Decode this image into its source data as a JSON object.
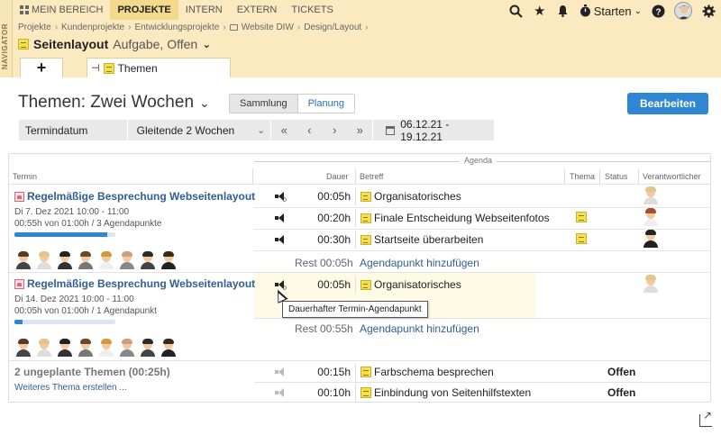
{
  "sidebar": {
    "label": "NAVIGATOR"
  },
  "topnav": {
    "items": [
      {
        "label": "MEIN BEREICH"
      },
      {
        "label": "PROJEKTE"
      },
      {
        "label": "INTERN"
      },
      {
        "label": "EXTERN"
      },
      {
        "label": "TICKETS"
      }
    ],
    "starten_label": "Starten"
  },
  "breadcrumb": [
    "Projekte",
    "Kundenprojekte",
    "Entwicklungsprojekte",
    "Website DIW",
    "Design/Layout"
  ],
  "page": {
    "title": "Seitenlayout",
    "subtitle": "Aufgabe, Offen"
  },
  "tabs": {
    "plus": "+",
    "doc_label": "Themen"
  },
  "view": {
    "title": "Themen: Zwei Wochen",
    "seg_off": "Sammlung",
    "seg_on": "Planung",
    "edit_button": "Bearbeiten"
  },
  "filter": {
    "label": "Termindatum",
    "select": "Gleitende 2 Wochen",
    "nav": [
      "<<",
      "<",
      ">",
      ">>"
    ],
    "range": "06.12.21 - 19.12.21"
  },
  "table": {
    "agenda_header": "Agenda",
    "headers": {
      "termin": "Termin",
      "dauer": "Dauer",
      "betreff": "Betreff",
      "thema": "Thema",
      "status": "Status",
      "verantw": "Verantwortlicher"
    }
  },
  "meetings": [
    {
      "title": "Regelmäßige Besprechung Webseitenlayout",
      "date": "Di 7. Dez 2021 10:00 - 11:00",
      "progress_text": "00:55h von 01:00h / 3 Agendapunkte",
      "progress": 0.92,
      "items": [
        {
          "dur": "00:05h",
          "subject": "Organisatorisches"
        },
        {
          "dur": "00:20h",
          "subject": "Finale Entscheidung Webseitenfotos"
        },
        {
          "dur": "00:30h",
          "subject": "Startseite überarbeiten"
        }
      ],
      "rest": "Rest 00:05h",
      "add": "Agendapunkt hinzufügen"
    },
    {
      "title": "Regelmäßige Besprechung Webseitenlayout",
      "date": "Di 14. Dez 2021 10:00 - 11:00",
      "progress_text": "00:05h von 01:00h / 1 Agendapunkt",
      "progress": 0.08,
      "items": [
        {
          "dur": "00:05h",
          "subject": "Organisatorisches"
        }
      ],
      "rest": "Rest 00:55h",
      "add": "Agendapunkt hinzufügen"
    }
  ],
  "unplanned": {
    "title": "2 ungeplante Themen (00:25h)",
    "create_link": "Weiteres Thema erstellen ...",
    "items": [
      {
        "dur": "00:15h",
        "subject": "Farbschema besprechen",
        "status": "Offen"
      },
      {
        "dur": "00:10h",
        "subject": "Einbindung von Seitenhilfstexten",
        "status": "Offen"
      }
    ]
  },
  "tooltip": "Dauerhafter Termin-Agendapunkt",
  "colors": {
    "accent": "#2f87d3",
    "header_bg": "#fbeac0",
    "link": "#2f5f93"
  },
  "icons": [
    "grid-icon",
    "search-icon",
    "star-icon",
    "bell-icon",
    "timer-icon",
    "help-icon",
    "avatar-icon",
    "gear-icon",
    "folder-icon",
    "note-icon",
    "pin-icon",
    "calendar-icon",
    "speaker-icon",
    "export-icon"
  ]
}
